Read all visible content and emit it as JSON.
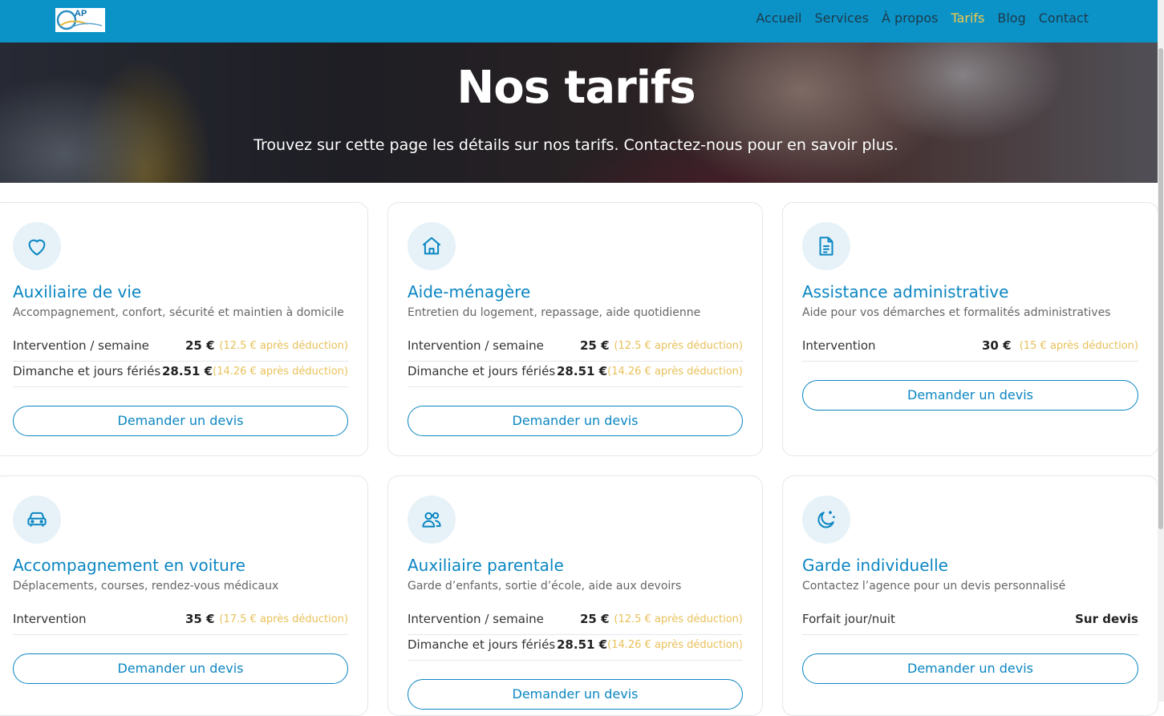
{
  "nav": {
    "logo_text": "AP",
    "links": [
      "Accueil",
      "Services",
      "À propos",
      "Tarifs",
      "Blog",
      "Contact"
    ],
    "active": "Tarifs"
  },
  "hero": {
    "title": "Nos tarifs",
    "subtitle": "Trouvez sur cette page les détails sur nos tarifs. Contactez-nous pour en savoir plus."
  },
  "colors": {
    "brand": "#0b93c8",
    "accent": "#0b86c2",
    "note": "#e8c15a",
    "nav_active": "#f2c94c"
  },
  "cards": [
    {
      "icon": "heart-icon",
      "title": "Auxiliaire de vie",
      "description": "Accompagnement, confort, sécurité et maintien à domicile",
      "rows": [
        {
          "label": "Intervention / semaine",
          "value": "25 €",
          "note": "(12.5 € après déduction)"
        },
        {
          "label": "Dimanche et jours fériés",
          "value": "28.51 €",
          "note": "(14.26 € après déduction)"
        }
      ],
      "button": "Demander un devis"
    },
    {
      "icon": "house-icon",
      "title": "Aide-ménagère",
      "description": "Entretien du logement, repassage, aide quotidienne",
      "rows": [
        {
          "label": "Intervention / semaine",
          "value": "25 €",
          "note": "(12.5 € après déduction)"
        },
        {
          "label": "Dimanche et jours fériés",
          "value": "28.51 €",
          "note": "(14.26 € après déduction)"
        }
      ],
      "button": "Demander un devis"
    },
    {
      "icon": "document-icon",
      "title": "Assistance administrative",
      "description": "Aide pour vos démarches et formalités administratives",
      "rows": [
        {
          "label": "Intervention",
          "value": "30 €",
          "note": "(15 € après déduction)"
        }
      ],
      "button": "Demander un devis"
    },
    {
      "icon": "car-icon",
      "title": "Accompagnement en voiture",
      "description": "Déplacements, courses, rendez-vous médicaux",
      "rows": [
        {
          "label": "Intervention",
          "value": "35 €",
          "note": "(17.5 € après déduction)"
        }
      ],
      "button": "Demander un devis"
    },
    {
      "icon": "users-icon",
      "title": "Auxiliaire parentale",
      "description": "Garde d’enfants, sortie d’école, aide aux devoirs",
      "rows": [
        {
          "label": "Intervention / semaine",
          "value": "25 €",
          "note": "(12.5 € après déduction)"
        },
        {
          "label": "Dimanche et jours fériés",
          "value": "28.51 €",
          "note": "(14.26 € après déduction)"
        }
      ],
      "button": "Demander un devis"
    },
    {
      "icon": "moon-stars-icon",
      "title": "Garde individuelle",
      "description": "Contactez l’agence pour un devis personnalisé",
      "rows": [
        {
          "label": "Forfait jour/nuit",
          "value": "Sur devis",
          "note": ""
        }
      ],
      "button": "Demander un devis"
    }
  ]
}
